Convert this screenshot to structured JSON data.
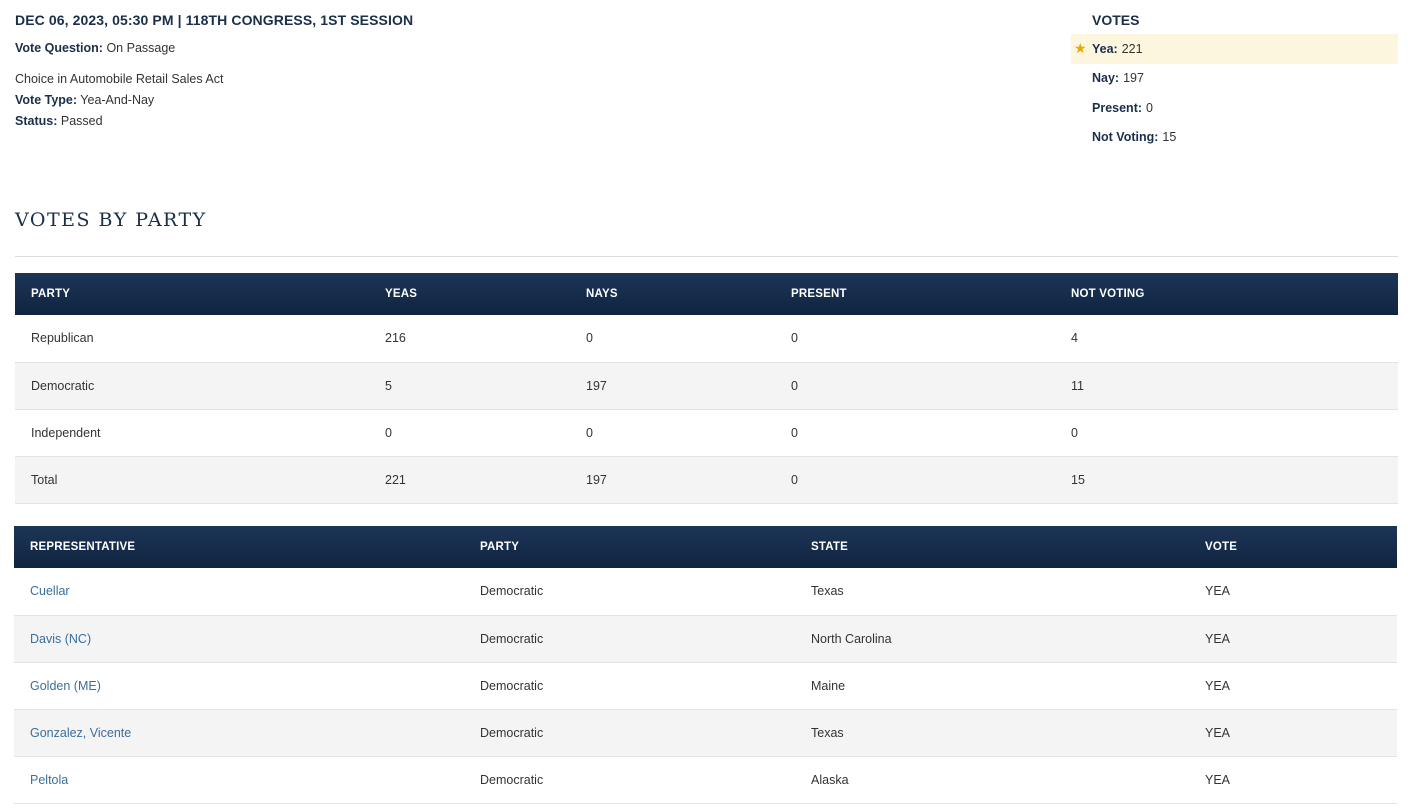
{
  "header": {
    "date_line": "DEC 06, 2023, 05:30 PM | 118TH CONGRESS, 1ST SESSION",
    "question_label": "Vote Question:",
    "question_value": "On Passage",
    "bill_title": "Choice in Automobile Retail Sales Act",
    "type_label": "Vote Type:",
    "type_value": "Yea-And-Nay",
    "status_label": "Status:",
    "status_value": "Passed"
  },
  "votes": {
    "title": "VOTES",
    "items": [
      {
        "label": "Yea:",
        "value": "221"
      },
      {
        "label": "Nay:",
        "value": "197"
      },
      {
        "label": "Present:",
        "value": "0"
      },
      {
        "label": "Not Voting:",
        "value": "15"
      }
    ]
  },
  "party_section": {
    "title": "VOTES BY PARTY",
    "headers": [
      "PARTY",
      "YEAS",
      "NAYS",
      "PRESENT",
      "NOT VOTING"
    ],
    "rows": [
      [
        "Republican",
        "216",
        "0",
        "0",
        "4"
      ],
      [
        "Democratic",
        "5",
        "197",
        "0",
        "11"
      ],
      [
        "Independent",
        "0",
        "0",
        "0",
        "0"
      ],
      [
        "Total",
        "221",
        "197",
        "0",
        "15"
      ]
    ]
  },
  "rep_table": {
    "headers": [
      "REPRESENTATIVE",
      "PARTY",
      "STATE",
      "VOTE"
    ],
    "rows": [
      [
        "Cuellar",
        "Democratic",
        "Texas",
        "YEA"
      ],
      [
        "Davis (NC)",
        "Democratic",
        "North Carolina",
        "YEA"
      ],
      [
        "Golden (ME)",
        "Democratic",
        "Maine",
        "YEA"
      ],
      [
        "Gonzalez, Vicente",
        "Democratic",
        "Texas",
        "YEA"
      ],
      [
        "Peltola",
        "Democratic",
        "Alaska",
        "YEA"
      ]
    ]
  },
  "colors": {
    "header_bg": "#1b2f4a",
    "highlight_bg": "#fdf6df",
    "link": "#3a6f9e",
    "star": "#e5a900"
  },
  "icons": {
    "yea_marker": "star-icon"
  }
}
